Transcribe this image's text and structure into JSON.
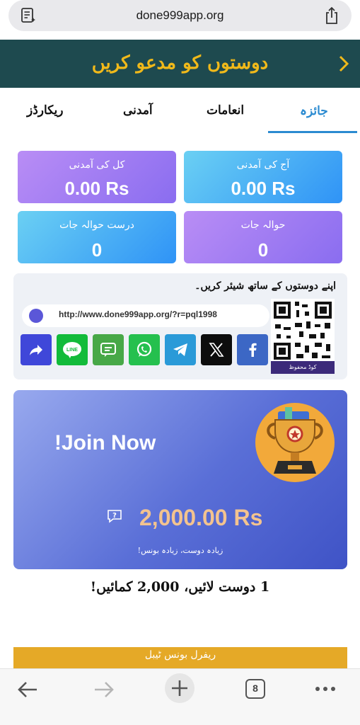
{
  "browser": {
    "url": "done999app.org",
    "tab_count": "8"
  },
  "header": {
    "title": "دوستوں کو مدعو کریں"
  },
  "tabs": [
    {
      "label": "جائزہ",
      "active": true
    },
    {
      "label": "انعامات",
      "active": false
    },
    {
      "label": "آمدنی",
      "active": false
    },
    {
      "label": "ریکارڈز",
      "active": false
    }
  ],
  "stats": {
    "today_income": {
      "label": "آج کی آمدنی",
      "value": "0.00 Rs"
    },
    "total_income": {
      "label": "کل کی آمدنی",
      "value": "0.00 Rs"
    },
    "referrals": {
      "label": "حوالہ جات",
      "value": "0"
    },
    "valid_referrals": {
      "label": "درست حوالہ جات",
      "value": "0"
    }
  },
  "share": {
    "title": "اپنے دوستوں کے ساتھ شیئر کریں۔",
    "link": "http://www.done999app.org/?r=pql1998",
    "qr_caption": "کوڈ محفوظ",
    "buttons": [
      "share",
      "line",
      "sms",
      "whatsapp",
      "telegram",
      "x",
      "facebook"
    ]
  },
  "promo": {
    "join": "Join Now!",
    "amount": "2,000.00 Rs",
    "subtitle": "زیادہ دوست، زیادہ بونس!"
  },
  "earn_text": "1 دوست لائیں، 2,000 کمائیں!",
  "bonus_bar": "ریفرل بونس ٹیبل",
  "colors": {
    "header_bg": "#1e4a4f",
    "header_text": "#f0b91a",
    "active_tab": "#2b8bd1",
    "bonus_bar": "#e5a927"
  }
}
